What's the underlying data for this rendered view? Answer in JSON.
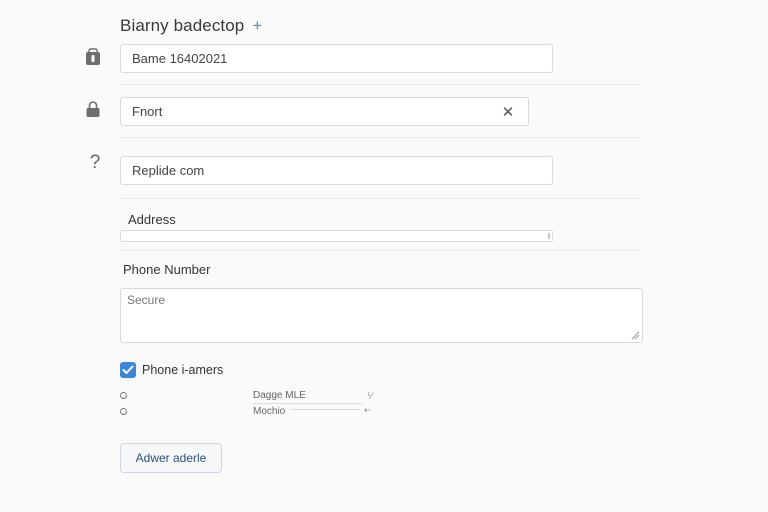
{
  "header": {
    "title": "Biarny badectop",
    "add_glyph": "+"
  },
  "rows": [
    {
      "icon": "wallet-icon",
      "value": "Bame 16402021"
    },
    {
      "icon": "lock-icon",
      "value": "Fnort",
      "clear_glyph": "✕"
    },
    {
      "icon": "help-icon",
      "icon_glyph": "?",
      "value": "Replide com"
    }
  ],
  "address": {
    "label": "Address"
  },
  "phone": {
    "label": "Phone Number",
    "textarea_value": "Secure"
  },
  "checkbox": {
    "label": "Phone i-amers",
    "checked": true,
    "color": "#3d85d8"
  },
  "options": [
    {
      "text": "Dagge MLE",
      "mark": "⅟"
    },
    {
      "text": "Mochio",
      "mark": "⇠"
    }
  ],
  "submit": {
    "label": "Adwer aderle"
  },
  "colors": {
    "accent": "#4a90d9",
    "border": "#d9d9d9",
    "background": "#fafafa"
  }
}
